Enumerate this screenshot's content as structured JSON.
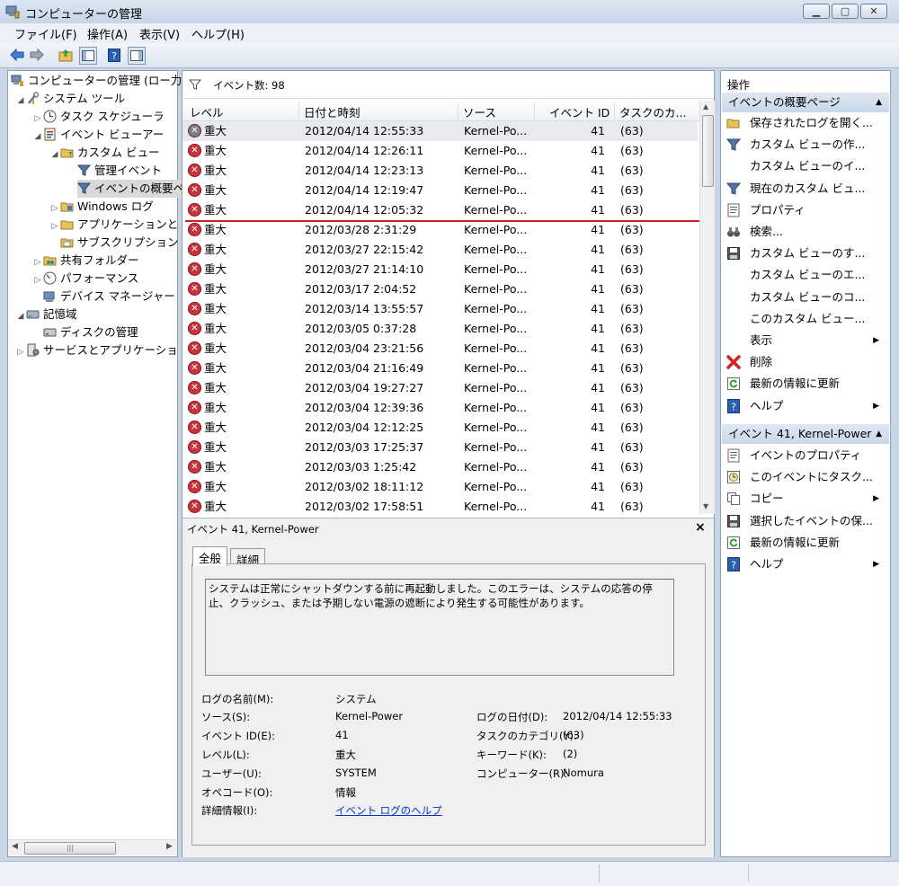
{
  "window": {
    "title": "コンピューターの管理"
  },
  "menu": [
    "ファイル(F)",
    "操作(A)",
    "表示(V)",
    "ヘルプ(H)"
  ],
  "tree": [
    {
      "label": "コンピューターの管理 (ロー力",
      "icon": "computer-management-icon"
    },
    {
      "label": "システム ツール",
      "icon": "tools-icon"
    },
    {
      "label": "タスク スケジューラ",
      "icon": "clock-icon"
    },
    {
      "label": "イベント ビューアー",
      "icon": "event-viewer-icon"
    },
    {
      "label": "カスタム ビュー",
      "icon": "folder-icon"
    },
    {
      "label": "管理イベント",
      "icon": "filter-icon"
    },
    {
      "label": "イベントの概要ペ",
      "icon": "filter-icon"
    },
    {
      "label": "Windows ログ",
      "icon": "folder-icon"
    },
    {
      "label": "アプリケーションと",
      "icon": "folder-icon"
    },
    {
      "label": "サブスクリプション",
      "icon": "subscription-icon"
    },
    {
      "label": "共有フォルダー",
      "icon": "shared-folder-icon"
    },
    {
      "label": "パフォーマンス",
      "icon": "performance-icon"
    },
    {
      "label": "デバイス マネージャー",
      "icon": "device-manager-icon"
    },
    {
      "label": "記憶域",
      "icon": "storage-icon"
    },
    {
      "label": "ディスクの管理",
      "icon": "disk-icon"
    },
    {
      "label": "サービスとアプリケーショ",
      "icon": "services-icon"
    }
  ],
  "events": {
    "count_label": "イベント数: 98",
    "columns": [
      "レベル",
      "日付と時刻",
      "ソース",
      "イベント ID",
      "タスクのカ..."
    ],
    "rows": [
      {
        "level": "重大",
        "datetime": "2012/04/14 12:55:33",
        "source": "Kernel-Po...",
        "id": "41",
        "task": "(63)"
      },
      {
        "level": "重大",
        "datetime": "2012/04/14 12:26:11",
        "source": "Kernel-Po...",
        "id": "41",
        "task": "(63)"
      },
      {
        "level": "重大",
        "datetime": "2012/04/14 12:23:13",
        "source": "Kernel-Po...",
        "id": "41",
        "task": "(63)"
      },
      {
        "level": "重大",
        "datetime": "2012/04/14 12:19:47",
        "source": "Kernel-Po...",
        "id": "41",
        "task": "(63)"
      },
      {
        "level": "重大",
        "datetime": "2012/04/14 12:05:32",
        "source": "Kernel-Po...",
        "id": "41",
        "task": "(63)"
      },
      {
        "level": "重大",
        "datetime": "2012/03/28 2:31:29",
        "source": "Kernel-Po...",
        "id": "41",
        "task": "(63)"
      },
      {
        "level": "重大",
        "datetime": "2012/03/27 22:15:42",
        "source": "Kernel-Po...",
        "id": "41",
        "task": "(63)"
      },
      {
        "level": "重大",
        "datetime": "2012/03/27 21:14:10",
        "source": "Kernel-Po...",
        "id": "41",
        "task": "(63)"
      },
      {
        "level": "重大",
        "datetime": "2012/03/17 2:04:52",
        "source": "Kernel-Po...",
        "id": "41",
        "task": "(63)"
      },
      {
        "level": "重大",
        "datetime": "2012/03/14 13:55:57",
        "source": "Kernel-Po...",
        "id": "41",
        "task": "(63)"
      },
      {
        "level": "重大",
        "datetime": "2012/03/05 0:37:28",
        "source": "Kernel-Po...",
        "id": "41",
        "task": "(63)"
      },
      {
        "level": "重大",
        "datetime": "2012/03/04 23:21:56",
        "source": "Kernel-Po...",
        "id": "41",
        "task": "(63)"
      },
      {
        "level": "重大",
        "datetime": "2012/03/04 21:16:49",
        "source": "Kernel-Po...",
        "id": "41",
        "task": "(63)"
      },
      {
        "level": "重大",
        "datetime": "2012/03/04 19:27:27",
        "source": "Kernel-Po...",
        "id": "41",
        "task": "(63)"
      },
      {
        "level": "重大",
        "datetime": "2012/03/04 12:39:36",
        "source": "Kernel-Po...",
        "id": "41",
        "task": "(63)"
      },
      {
        "level": "重大",
        "datetime": "2012/03/04 12:12:25",
        "source": "Kernel-Po...",
        "id": "41",
        "task": "(63)"
      },
      {
        "level": "重大",
        "datetime": "2012/03/03 17:25:37",
        "source": "Kernel-Po...",
        "id": "41",
        "task": "(63)"
      },
      {
        "level": "重大",
        "datetime": "2012/03/03 1:25:42",
        "source": "Kernel-Po...",
        "id": "41",
        "task": "(63)"
      },
      {
        "level": "重大",
        "datetime": "2012/03/02 18:11:12",
        "source": "Kernel-Po...",
        "id": "41",
        "task": "(63)"
      },
      {
        "level": "重大",
        "datetime": "2012/03/02 17:58:51",
        "source": "Kernel-Po...",
        "id": "41",
        "task": "(63)"
      }
    ]
  },
  "detail": {
    "title": "イベント 41, Kernel-Power",
    "tabs": [
      "全般",
      "詳細"
    ],
    "description": "システムは正常にシャットダウンする前に再起動しました。このエラーは、システムの応答の停止、クラッシュ、または予期しない電源の遮断により発生する可能性があります。",
    "fields": {
      "log_name_label": "ログの名前(M):",
      "log_name": "システム",
      "source_label": "ソース(S):",
      "source": "Kernel-Power",
      "logged_label": "ログの日付(D):",
      "logged": "2012/04/14 12:55:33",
      "event_id_label": "イベント ID(E):",
      "event_id": "41",
      "task_label": "タスクのカテゴリ(Y):",
      "task": "(63)",
      "level_label": "レベル(L):",
      "level": "重大",
      "keywords_label": "キーワード(K):",
      "keywords": "(2)",
      "user_label": "ユーザー(U):",
      "user": "SYSTEM",
      "computer_label": "コンピューター(R):",
      "computer": "Nomura",
      "opcode_label": "オペコード(O):",
      "opcode": "情報",
      "more_info_label": "詳細情報(I):",
      "more_info_link": "イベント ログのヘルプ"
    }
  },
  "actions": {
    "title": "操作",
    "section1": "イベントの概要ページ",
    "items1": [
      {
        "label": "保存されたログを開く...",
        "icon": "open-folder-icon"
      },
      {
        "label": "カスタム ビューの作...",
        "icon": "filter-icon"
      },
      {
        "label": "カスタム ビューのイ...",
        "icon": ""
      },
      {
        "label": "現在のカスタム ビュ...",
        "icon": "filter-icon"
      },
      {
        "label": "プロパティ",
        "icon": "properties-icon"
      },
      {
        "label": "検索...",
        "icon": "binoculars-icon"
      },
      {
        "label": "カスタム ビューのす...",
        "icon": "save-icon"
      },
      {
        "label": "カスタム ビューのエ...",
        "icon": ""
      },
      {
        "label": "カスタム ビューのコ...",
        "icon": ""
      },
      {
        "label": "このカスタム ビュー...",
        "icon": ""
      },
      {
        "label": "表示",
        "icon": "",
        "submenu": true
      },
      {
        "label": "削除",
        "icon": "delete-icon"
      },
      {
        "label": "最新の情報に更新",
        "icon": "refresh-icon"
      },
      {
        "label": "ヘルプ",
        "icon": "help-icon",
        "submenu": true
      }
    ],
    "section2": "イベント 41, Kernel-Power",
    "items2": [
      {
        "label": "イベントのプロパティ",
        "icon": "properties-icon"
      },
      {
        "label": "このイベントにタスク...",
        "icon": "task-icon"
      },
      {
        "label": "コピー",
        "icon": "copy-icon",
        "submenu": true
      },
      {
        "label": "選択したイベントの保...",
        "icon": "save-icon"
      },
      {
        "label": "最新の情報に更新",
        "icon": "refresh-icon"
      },
      {
        "label": "ヘルプ",
        "icon": "help-icon",
        "submenu": true
      }
    ]
  },
  "colors": {
    "critical": "#c8343e",
    "selection_line": "#cc1f1f",
    "link": "#0033cc"
  }
}
